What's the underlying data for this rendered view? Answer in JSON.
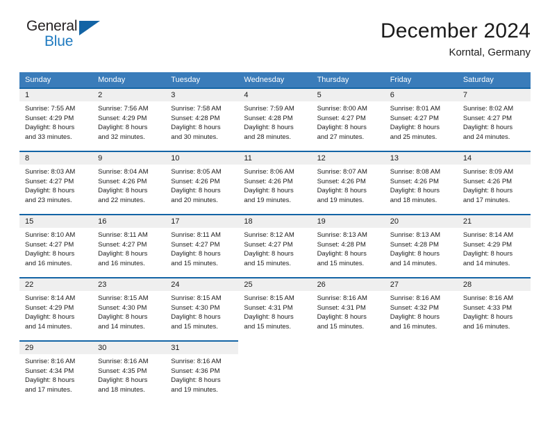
{
  "brand": {
    "name_top": "General",
    "name_bottom": "Blue",
    "accent_color": "#1364a5",
    "text_color": "#231f20"
  },
  "header": {
    "month_title": "December 2024",
    "location": "Korntal, Germany"
  },
  "theme": {
    "header_row_color": "#3a7cba",
    "row_divider_color": "#1364a5",
    "daynum_band_color": "#efefef",
    "page_background": "#ffffff"
  },
  "weekday_headers": [
    "Sunday",
    "Monday",
    "Tuesday",
    "Wednesday",
    "Thursday",
    "Friday",
    "Saturday"
  ],
  "weeks": [
    [
      {
        "day": "1",
        "sunrise": "Sunrise: 7:55 AM",
        "sunset": "Sunset: 4:29 PM",
        "daylight_1": "Daylight: 8 hours",
        "daylight_2": "and 33 minutes."
      },
      {
        "day": "2",
        "sunrise": "Sunrise: 7:56 AM",
        "sunset": "Sunset: 4:29 PM",
        "daylight_1": "Daylight: 8 hours",
        "daylight_2": "and 32 minutes."
      },
      {
        "day": "3",
        "sunrise": "Sunrise: 7:58 AM",
        "sunset": "Sunset: 4:28 PM",
        "daylight_1": "Daylight: 8 hours",
        "daylight_2": "and 30 minutes."
      },
      {
        "day": "4",
        "sunrise": "Sunrise: 7:59 AM",
        "sunset": "Sunset: 4:28 PM",
        "daylight_1": "Daylight: 8 hours",
        "daylight_2": "and 28 minutes."
      },
      {
        "day": "5",
        "sunrise": "Sunrise: 8:00 AM",
        "sunset": "Sunset: 4:27 PM",
        "daylight_1": "Daylight: 8 hours",
        "daylight_2": "and 27 minutes."
      },
      {
        "day": "6",
        "sunrise": "Sunrise: 8:01 AM",
        "sunset": "Sunset: 4:27 PM",
        "daylight_1": "Daylight: 8 hours",
        "daylight_2": "and 25 minutes."
      },
      {
        "day": "7",
        "sunrise": "Sunrise: 8:02 AM",
        "sunset": "Sunset: 4:27 PM",
        "daylight_1": "Daylight: 8 hours",
        "daylight_2": "and 24 minutes."
      }
    ],
    [
      {
        "day": "8",
        "sunrise": "Sunrise: 8:03 AM",
        "sunset": "Sunset: 4:27 PM",
        "daylight_1": "Daylight: 8 hours",
        "daylight_2": "and 23 minutes."
      },
      {
        "day": "9",
        "sunrise": "Sunrise: 8:04 AM",
        "sunset": "Sunset: 4:26 PM",
        "daylight_1": "Daylight: 8 hours",
        "daylight_2": "and 22 minutes."
      },
      {
        "day": "10",
        "sunrise": "Sunrise: 8:05 AM",
        "sunset": "Sunset: 4:26 PM",
        "daylight_1": "Daylight: 8 hours",
        "daylight_2": "and 20 minutes."
      },
      {
        "day": "11",
        "sunrise": "Sunrise: 8:06 AM",
        "sunset": "Sunset: 4:26 PM",
        "daylight_1": "Daylight: 8 hours",
        "daylight_2": "and 19 minutes."
      },
      {
        "day": "12",
        "sunrise": "Sunrise: 8:07 AM",
        "sunset": "Sunset: 4:26 PM",
        "daylight_1": "Daylight: 8 hours",
        "daylight_2": "and 19 minutes."
      },
      {
        "day": "13",
        "sunrise": "Sunrise: 8:08 AM",
        "sunset": "Sunset: 4:26 PM",
        "daylight_1": "Daylight: 8 hours",
        "daylight_2": "and 18 minutes."
      },
      {
        "day": "14",
        "sunrise": "Sunrise: 8:09 AM",
        "sunset": "Sunset: 4:26 PM",
        "daylight_1": "Daylight: 8 hours",
        "daylight_2": "and 17 minutes."
      }
    ],
    [
      {
        "day": "15",
        "sunrise": "Sunrise: 8:10 AM",
        "sunset": "Sunset: 4:27 PM",
        "daylight_1": "Daylight: 8 hours",
        "daylight_2": "and 16 minutes."
      },
      {
        "day": "16",
        "sunrise": "Sunrise: 8:11 AM",
        "sunset": "Sunset: 4:27 PM",
        "daylight_1": "Daylight: 8 hours",
        "daylight_2": "and 16 minutes."
      },
      {
        "day": "17",
        "sunrise": "Sunrise: 8:11 AM",
        "sunset": "Sunset: 4:27 PM",
        "daylight_1": "Daylight: 8 hours",
        "daylight_2": "and 15 minutes."
      },
      {
        "day": "18",
        "sunrise": "Sunrise: 8:12 AM",
        "sunset": "Sunset: 4:27 PM",
        "daylight_1": "Daylight: 8 hours",
        "daylight_2": "and 15 minutes."
      },
      {
        "day": "19",
        "sunrise": "Sunrise: 8:13 AM",
        "sunset": "Sunset: 4:28 PM",
        "daylight_1": "Daylight: 8 hours",
        "daylight_2": "and 15 minutes."
      },
      {
        "day": "20",
        "sunrise": "Sunrise: 8:13 AM",
        "sunset": "Sunset: 4:28 PM",
        "daylight_1": "Daylight: 8 hours",
        "daylight_2": "and 14 minutes."
      },
      {
        "day": "21",
        "sunrise": "Sunrise: 8:14 AM",
        "sunset": "Sunset: 4:29 PM",
        "daylight_1": "Daylight: 8 hours",
        "daylight_2": "and 14 minutes."
      }
    ],
    [
      {
        "day": "22",
        "sunrise": "Sunrise: 8:14 AM",
        "sunset": "Sunset: 4:29 PM",
        "daylight_1": "Daylight: 8 hours",
        "daylight_2": "and 14 minutes."
      },
      {
        "day": "23",
        "sunrise": "Sunrise: 8:15 AM",
        "sunset": "Sunset: 4:30 PM",
        "daylight_1": "Daylight: 8 hours",
        "daylight_2": "and 14 minutes."
      },
      {
        "day": "24",
        "sunrise": "Sunrise: 8:15 AM",
        "sunset": "Sunset: 4:30 PM",
        "daylight_1": "Daylight: 8 hours",
        "daylight_2": "and 15 minutes."
      },
      {
        "day": "25",
        "sunrise": "Sunrise: 8:15 AM",
        "sunset": "Sunset: 4:31 PM",
        "daylight_1": "Daylight: 8 hours",
        "daylight_2": "and 15 minutes."
      },
      {
        "day": "26",
        "sunrise": "Sunrise: 8:16 AM",
        "sunset": "Sunset: 4:31 PM",
        "daylight_1": "Daylight: 8 hours",
        "daylight_2": "and 15 minutes."
      },
      {
        "day": "27",
        "sunrise": "Sunrise: 8:16 AM",
        "sunset": "Sunset: 4:32 PM",
        "daylight_1": "Daylight: 8 hours",
        "daylight_2": "and 16 minutes."
      },
      {
        "day": "28",
        "sunrise": "Sunrise: 8:16 AM",
        "sunset": "Sunset: 4:33 PM",
        "daylight_1": "Daylight: 8 hours",
        "daylight_2": "and 16 minutes."
      }
    ],
    [
      {
        "day": "29",
        "sunrise": "Sunrise: 8:16 AM",
        "sunset": "Sunset: 4:34 PM",
        "daylight_1": "Daylight: 8 hours",
        "daylight_2": "and 17 minutes."
      },
      {
        "day": "30",
        "sunrise": "Sunrise: 8:16 AM",
        "sunset": "Sunset: 4:35 PM",
        "daylight_1": "Daylight: 8 hours",
        "daylight_2": "and 18 minutes."
      },
      {
        "day": "31",
        "sunrise": "Sunrise: 8:16 AM",
        "sunset": "Sunset: 4:36 PM",
        "daylight_1": "Daylight: 8 hours",
        "daylight_2": "and 19 minutes."
      },
      {
        "day": "",
        "sunrise": "",
        "sunset": "",
        "daylight_1": "",
        "daylight_2": ""
      },
      {
        "day": "",
        "sunrise": "",
        "sunset": "",
        "daylight_1": "",
        "daylight_2": ""
      },
      {
        "day": "",
        "sunrise": "",
        "sunset": "",
        "daylight_1": "",
        "daylight_2": ""
      },
      {
        "day": "",
        "sunrise": "",
        "sunset": "",
        "daylight_1": "",
        "daylight_2": ""
      }
    ]
  ]
}
